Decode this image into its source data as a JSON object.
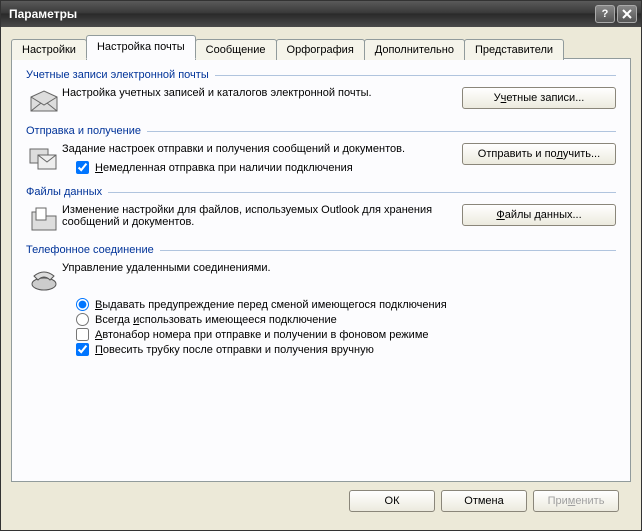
{
  "window": {
    "title": "Параметры"
  },
  "tabs": {
    "settings": "Настройки",
    "mail_setup": "Настройка почты",
    "message": "Сообщение",
    "spelling": "Орфография",
    "advanced": "Дополнительно",
    "delegates": "Представители"
  },
  "accounts": {
    "header": "Учетные записи электронной почты",
    "desc": "Настройка учетных записей и каталогов электронной почты.",
    "button_prefix": "У",
    "button_accel": "ч",
    "button_suffix": "етные записи..."
  },
  "sendrecv": {
    "header": "Отправка и получение",
    "desc": "Задание настроек отправки и получения сообщений и документов.",
    "check_accel": "Н",
    "check_suffix": "емедленная отправка при наличии подключения",
    "button_prefix": "Отправить и по",
    "button_accel": "л",
    "button_suffix": "учить..."
  },
  "datafiles": {
    "header": "Файлы данных",
    "desc": "Изменение настройки для файлов, используемых Outlook для хранения сообщений и документов.",
    "button_accel": "Ф",
    "button_suffix": "айлы данных..."
  },
  "dialup": {
    "header": "Телефонное соединение",
    "desc": "Управление удаленными соединениями.",
    "radio_warn_accel": "В",
    "radio_warn_suffix": "ыдавать предупреждение перед сменой имеющегося подключения",
    "radio_always_prefix": "Всегда ",
    "radio_always_accel": "и",
    "radio_always_suffix": "спользовать имеющееся подключение",
    "check_auto_accel": "А",
    "check_auto_suffix": "втонабор номера при отправке и получении в фоновом режиме",
    "check_hangup_accel": "П",
    "check_hangup_suffix": "овесить трубку после отправки и получения вручную"
  },
  "footer": {
    "ok": "ОК",
    "cancel": "Отмена",
    "apply_prefix": "При",
    "apply_accel": "м",
    "apply_suffix": "енить"
  }
}
